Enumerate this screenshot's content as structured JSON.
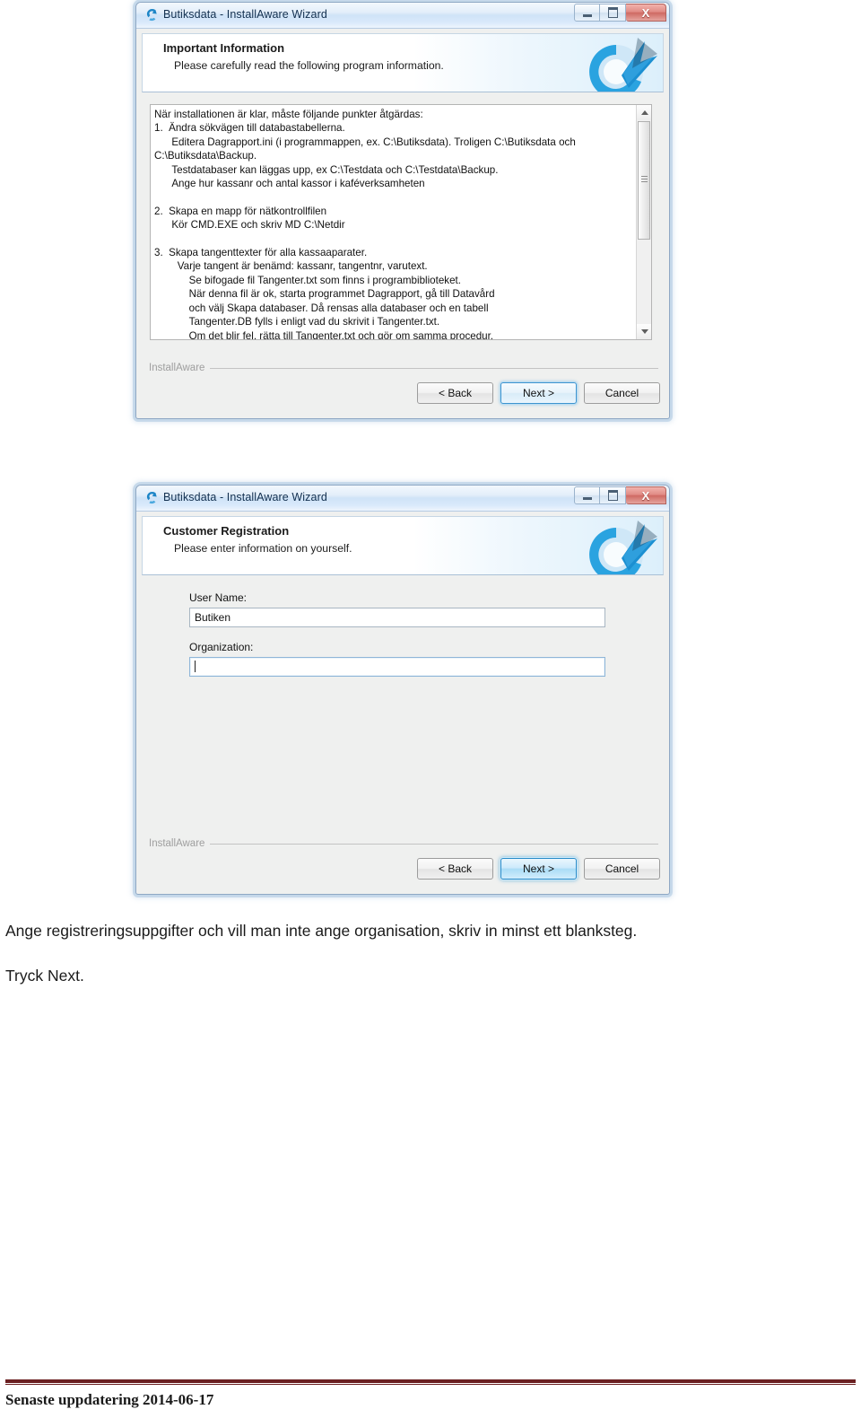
{
  "page": {
    "prose_line_1": "Ange registreringsuppgifter och vill man inte ange organisation, skriv in minst ett blanksteg.",
    "prose_line_2": "Tryck Next.",
    "footer_text": "Senaste uppdatering 2014-06-17",
    "footer_rule_color": "#6b1f21"
  },
  "wizard_1": {
    "titlebar": {
      "title": "Butiksdata - InstallAware Wizard",
      "icon": "installaware-swirl-icon",
      "minimize_label": "–",
      "maximize_label": "□",
      "close_label": "X"
    },
    "header": {
      "title": "Important Information",
      "subtitle": "Please carefully read the following program information.",
      "logo": "blue-circular-arrow-logo"
    },
    "info_text": "När installationen är klar, måste följande punkter åtgärdas:\n1.  Ändra sökvägen till databastabellerna.\n      Editera Dagrapport.ini (i programmappen, ex. C:\\Butiksdata). Troligen C:\\Butiksdata och\nC:\\Butiksdata\\Backup.\n      Testdatabaser kan läggas upp, ex C:\\Testdata och C:\\Testdata\\Backup.\n      Ange hur kassanr och antal kassor i kaféverksamheten\n\n2.  Skapa en mapp för nätkontrollfilen\n      Kör CMD.EXE och skriv MD C:\\Netdir\n\n3.  Skapa tangenttexter för alla kassaaparater.\n        Varje tangent är benämd: kassanr, tangentnr, varutext.\n            Se bifogade fil Tangenter.txt som finns i programbiblioteket.\n            När denna fil är ok, starta programmet Dagrapport, gå till Datavård\n            och välj Skapa databaser. Då rensas alla databaser och en tabell\n            Tangenter.DB fylls i enligt vad du skrivit i Tangenter.txt.\n            Om det blir fel, rätta till Tangenter.txt och gör om samma procedur.",
    "scrollbar": {
      "up_arrow": "scroll-up-arrow-icon",
      "down_arrow": "scroll-down-arrow-icon"
    },
    "footer": {
      "brand": "InstallAware",
      "back_label": "< Back",
      "next_label": "Next >",
      "cancel_label": "Cancel"
    }
  },
  "wizard_2": {
    "titlebar": {
      "title": "Butiksdata - InstallAware Wizard",
      "icon": "installaware-swirl-icon",
      "minimize_label": "–",
      "maximize_label": "□",
      "close_label": "X"
    },
    "header": {
      "title": "Customer Registration",
      "subtitle": "Please enter information on yourself.",
      "logo": "blue-circular-arrow-logo"
    },
    "form": {
      "user_name_label": "User Name:",
      "user_name_value": "Butiken",
      "organization_label": "Organization:",
      "organization_value": ""
    },
    "footer": {
      "brand": "InstallAware",
      "back_label": "< Back",
      "next_label": "Next >",
      "cancel_label": "Cancel"
    }
  }
}
